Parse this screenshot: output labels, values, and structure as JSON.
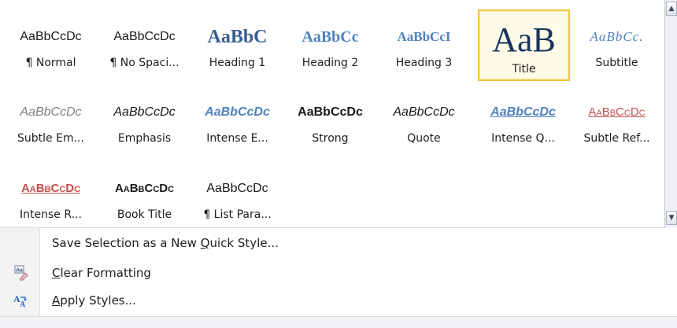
{
  "gallery": {
    "styles": [
      {
        "id": "normal",
        "preview": "AaBbCcDc",
        "label": "¶ Normal",
        "class": "p-normal"
      },
      {
        "id": "no-spacing",
        "preview": "AaBbCcDc",
        "label": "¶ No Spaci...",
        "class": "p-normal"
      },
      {
        "id": "heading-1",
        "preview": "AaBbC",
        "label": "Heading 1",
        "class": "p-h1"
      },
      {
        "id": "heading-2",
        "preview": "AaBbCc",
        "label": "Heading 2",
        "class": "p-h2"
      },
      {
        "id": "heading-3",
        "preview": "AaBbCcI",
        "label": "Heading 3",
        "class": "p-h3"
      },
      {
        "id": "title",
        "preview": "AaB",
        "label": "Title",
        "class": "p-title",
        "selected": true
      },
      {
        "id": "subtitle",
        "preview": "AaBbCc.",
        "label": "Subtitle",
        "class": "p-subtitle"
      },
      {
        "id": "subtle-emphasis",
        "preview": "AaBbCcDc",
        "label": "Subtle Em...",
        "class": "p-subtle"
      },
      {
        "id": "emphasis",
        "preview": "AaBbCcDc",
        "label": "Emphasis",
        "class": "p-emph"
      },
      {
        "id": "intense-emphasis",
        "preview": "AaBbCcDc",
        "label": "Intense E...",
        "class": "p-intemph"
      },
      {
        "id": "strong",
        "preview": "AaBbCcDc",
        "label": "Strong",
        "class": "p-strong"
      },
      {
        "id": "quote",
        "preview": "AaBbCcDc",
        "label": "Quote",
        "class": "p-quote"
      },
      {
        "id": "intense-quote",
        "preview": "AaBbCcDc",
        "label": "Intense Q...",
        "class": "p-intquote"
      },
      {
        "id": "subtle-reference",
        "preview": "AaBbCcDc",
        "label": "Subtle Ref...",
        "class": "p-subref"
      },
      {
        "id": "intense-reference",
        "preview": "AaBbCcDc",
        "label": "Intense R...",
        "class": "p-intref"
      },
      {
        "id": "book-title",
        "preview": "AaBbCcDc",
        "label": "Book Title",
        "class": "p-book"
      },
      {
        "id": "list-paragraph",
        "preview": "AaBbCcDc",
        "label": "¶ List Para...",
        "class": "p-list"
      }
    ]
  },
  "menu": {
    "save_style": {
      "pre": "Save Selection as a New ",
      "accel": "Q",
      "post": "uick Style..."
    },
    "clear_formatting": {
      "pre": "",
      "accel": "C",
      "post": "lear Formatting"
    },
    "apply_styles": {
      "pre": "",
      "accel": "A",
      "post": "pply Styles..."
    }
  },
  "colors": {
    "selected_border": "#f2c64a",
    "heading_blue": "#4f81bd",
    "reference_red": "#c0504d"
  }
}
